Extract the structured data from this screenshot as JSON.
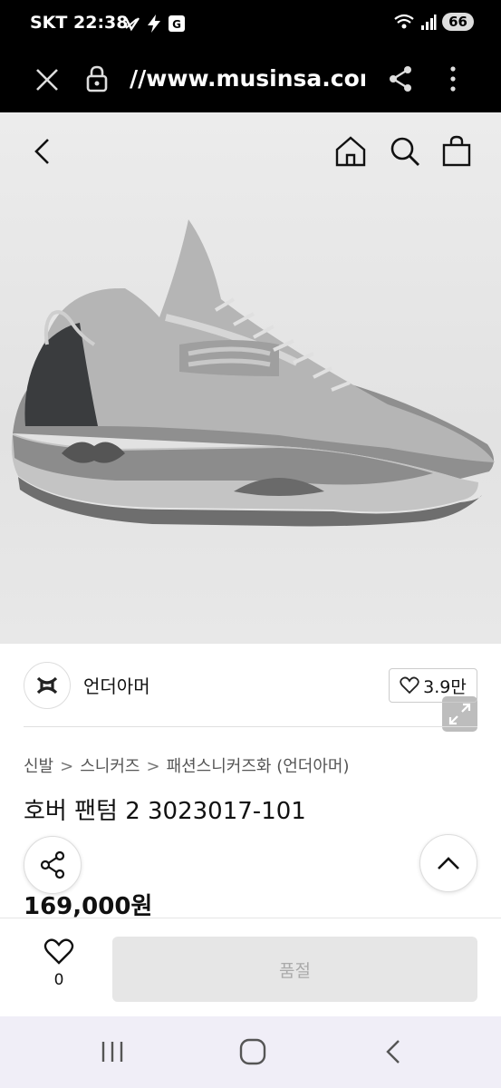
{
  "status_bar": {
    "carrier": "SKT",
    "time": "22:38",
    "battery": "66"
  },
  "browser": {
    "url": "//www.musinsa.com/p"
  },
  "brand": {
    "name": "언더아머",
    "likes": "3.9만"
  },
  "breadcrumb": [
    "신발",
    "스니커즈",
    "패션스니커즈화 (언더아머)"
  ],
  "breadcrumb_separator": ">",
  "product": {
    "title": "호버 팬텀 2 3023017-101",
    "price": "169,000원"
  },
  "bottom_bar": {
    "wish_count": "0",
    "soldout_label": "품절"
  },
  "colors": {
    "hero_bg": "#e8e8e8",
    "button_disabled": "#e6e6e6",
    "nav_bg": "#f0eef7"
  },
  "icons": [
    "close-icon",
    "lock-icon",
    "share-icon",
    "more-icon",
    "back-icon",
    "home-icon",
    "search-icon",
    "bag-icon",
    "expand-icon",
    "heart-icon",
    "chevron-up-icon",
    "recent-apps-icon",
    "home-nav-icon",
    "back-nav-icon"
  ]
}
